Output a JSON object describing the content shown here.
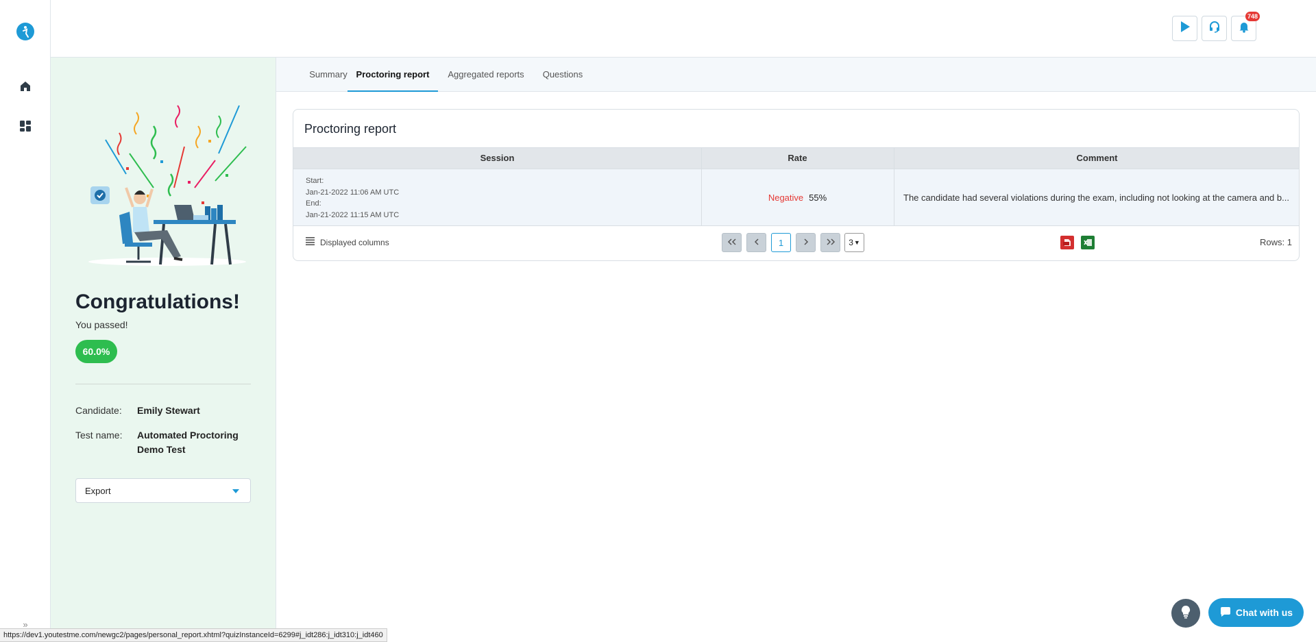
{
  "header": {
    "notifications_count": "748"
  },
  "sidebar_rail": {
    "icons": [
      "logo-icon",
      "home-icon",
      "dashboard-icon",
      "expand-icon"
    ]
  },
  "result": {
    "heading": "Congratulations!",
    "status": "You passed!",
    "score": "60.0%",
    "candidate_label": "Candidate:",
    "candidate_value": "Emily Stewart",
    "test_label": "Test name:",
    "test_value": "Automated Proctoring Demo Test",
    "export_label": "Export"
  },
  "tabs": [
    {
      "label": "Summary",
      "active": false
    },
    {
      "label": "Proctoring report",
      "active": true
    },
    {
      "label": "Aggregated reports",
      "active": false
    },
    {
      "label": "Questions",
      "active": false
    }
  ],
  "report": {
    "title": "Proctoring report",
    "columns": [
      "Session",
      "Rate",
      "Comment"
    ],
    "rows": [
      {
        "start_label": "Start:",
        "start": "Jan-21-2022 11:06 AM UTC",
        "end_label": "End:",
        "end": "Jan-21-2022 11:15 AM UTC",
        "rate_label": "Negative",
        "rate_value": "55%",
        "comment": "The candidate had several violations during the exam, including not looking at the camera and b..."
      }
    ],
    "displayed_columns_label": "Displayed columns",
    "current_page": "1",
    "rows_per_page": "3",
    "rows_total": "Rows: 1"
  },
  "floating": {
    "chat_label": "Chat with us"
  },
  "status_url": "https://dev1.youtestme.com/newgc2/pages/personal_report.xhtml?quizInstanceId=6299#j_idt286:j_idt310:j_idt460",
  "colors": {
    "accent": "#1e9ad6",
    "success": "#2ebd4f",
    "negative": "#e53935",
    "side_panel": "#eaf7ef"
  }
}
